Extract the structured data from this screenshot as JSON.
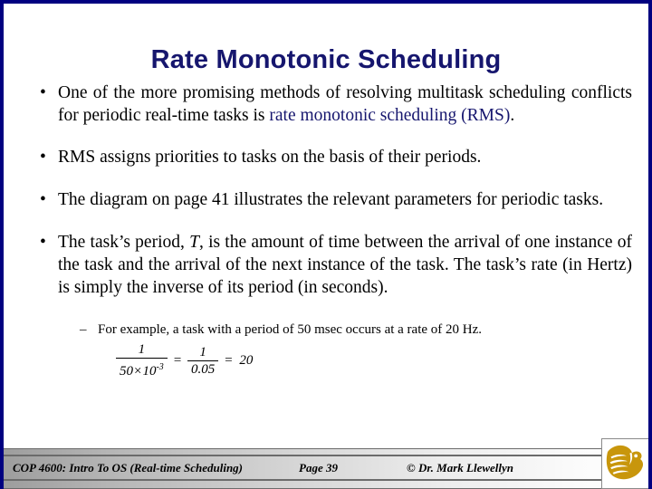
{
  "slide": {
    "title": "Rate Monotonic Scheduling",
    "border_color": "#000080",
    "title_color": "#16166e",
    "background_color": "#ffffff"
  },
  "bullets": [
    {
      "marker": "•",
      "text_plain": "One of the more promising methods of resolving multitask scheduling conflicts for periodic real-time tasks is rate monotonic scheduling (RMS).",
      "lead": "One of the more promising methods of resolving multitask scheduling conflicts for periodic real-time tasks is ",
      "accent": "rate monotonic scheduling (RMS)",
      "tail": "."
    },
    {
      "marker": "•",
      "text_plain": "RMS assigns priorities to tasks on the basis of their periods."
    },
    {
      "marker": "•",
      "text_plain": "The diagram on page 41 illustrates the relevant parameters for periodic tasks."
    },
    {
      "marker": "•",
      "text_plain": "The task’s period, T, is the amount of time between the arrival of one instance of the task and the arrival of the next instance of the task.  The task’s rate (in Hertz) is simply the inverse of its period (in seconds).",
      "part1": "The task’s period, ",
      "italic_var": "T",
      "part2": ", is the amount of time between the arrival of one instance of the task and the arrival of the next instance of the task.  The task’s rate (in Hertz) is simply the inverse of its period (in seconds)."
    }
  ],
  "sub_bullet": {
    "marker": "–",
    "text": "For example, a task with a period of 50 msec occurs at a rate of 20 Hz."
  },
  "equation": {
    "latex_like": "1 / (50 × 10^-3) = 1 / 0.05 = 20",
    "frac1_numerator": "1",
    "frac1_denominator_base": "50",
    "frac1_denominator_times": "×",
    "frac1_denominator_power_base": "10",
    "frac1_denominator_exponent": "-3",
    "equals_1": "=",
    "frac2_numerator": "1",
    "frac2_denominator": "0.05",
    "equals_2": "=",
    "result": "20"
  },
  "footer": {
    "course": "COP 4600: Intro To OS  (Real-time Scheduling)",
    "page": "Page 39",
    "author": "© Dr. Mark Llewellyn",
    "logo_name": "ucf-pegasus-logo",
    "logo_color": "#c8960c"
  }
}
